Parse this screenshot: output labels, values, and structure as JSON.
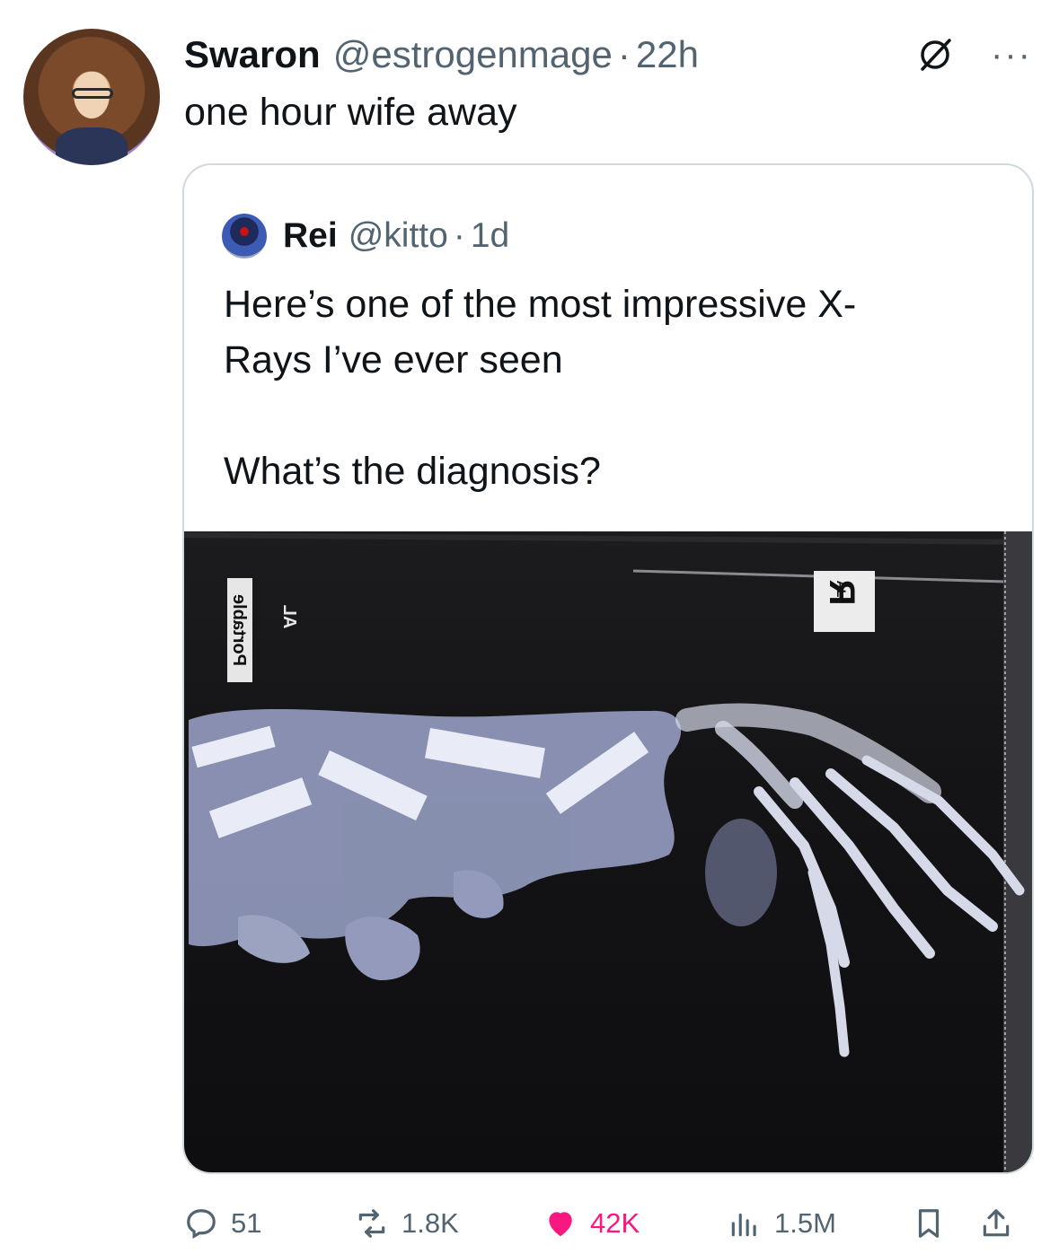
{
  "post": {
    "author_name": "Swaron",
    "author_handle": "@estrogenmage",
    "separator": "·",
    "time": "22h",
    "text": "one hour wife away",
    "more_label": "···"
  },
  "quoted": {
    "author_name": "Rei",
    "author_handle": "@kitto",
    "separator": "·",
    "time": "1d",
    "text": "Here’s one of the most impressive X-\nRays I’ve ever seen\n\nWhat’s the diagnosis?",
    "xray_markers": {
      "left_label_1": "Portable",
      "left_label_2": "AL",
      "right_label": "R",
      "right_sub": "AL"
    }
  },
  "actions": {
    "replies": "51",
    "reposts": "1.8K",
    "likes": "42K",
    "views": "1.5M"
  },
  "icons": {
    "reply": "reply-icon",
    "repost": "repost-icon",
    "like": "heart-icon",
    "views": "views-chart-icon",
    "bookmark": "bookmark-icon",
    "share": "share-icon",
    "grok": "grok-icon",
    "more": "more-icon"
  },
  "colors": {
    "text_primary": "#0f1419",
    "text_secondary": "#536471",
    "like_pink": "#f91880",
    "border": "#cfd9de"
  }
}
